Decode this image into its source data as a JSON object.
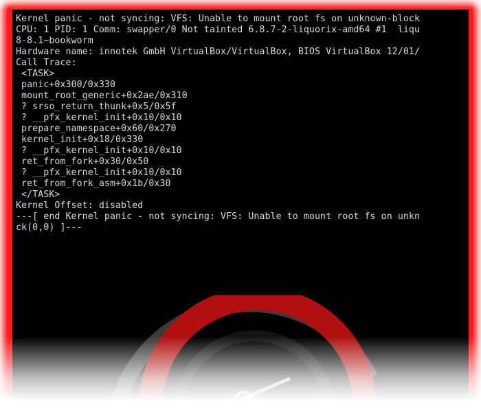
{
  "console": {
    "lines": [
      "Kernel panic - not syncing: VFS: Unable to mount root fs on unknown-block",
      "CPU: 1 PID: 1 Comm: swapper/0 Not tainted 6.8.7-2-liquorix-amd64 #1  liqu",
      "8-8.1~bookworm",
      "Hardware name: innotek GmbH VirtualBox/VirtualBox, BIOS VirtualBox 12/01/",
      "Call Trace:",
      " <TASK>",
      " panic+0x300/0x330",
      " mount_root_generic+0x2ae/0x310",
      " ? srso_return_thunk+0x5/0x5f",
      " ? __pfx_kernel_init+0x10/0x10",
      " prepare_namespace+0x60/0x270",
      " kernel_init+0x18/0x330",
      " ? __pfx_kernel_init+0x10/0x10",
      " ret_from_fork+0x30/0x50",
      " ? __pfx_kernel_init+0x10/0x10",
      " ret_from_fork_asm+0x1b/0x30",
      " </TASK>",
      "Kernel Offset: disabled",
      "---[ end Kernel panic - not syncing: VFS: Unable to mount root fs on unkn",
      "ck(0,0) ]---"
    ]
  },
  "colors": {
    "glow": "#ff1a1a",
    "screen_background": "#000000",
    "console_text": "#d8d8d8",
    "gauge_arc": "#b01010",
    "gauge_needle": "#c0c0c0"
  },
  "icons": {
    "gauge": "speedometer-gauge-icon"
  }
}
